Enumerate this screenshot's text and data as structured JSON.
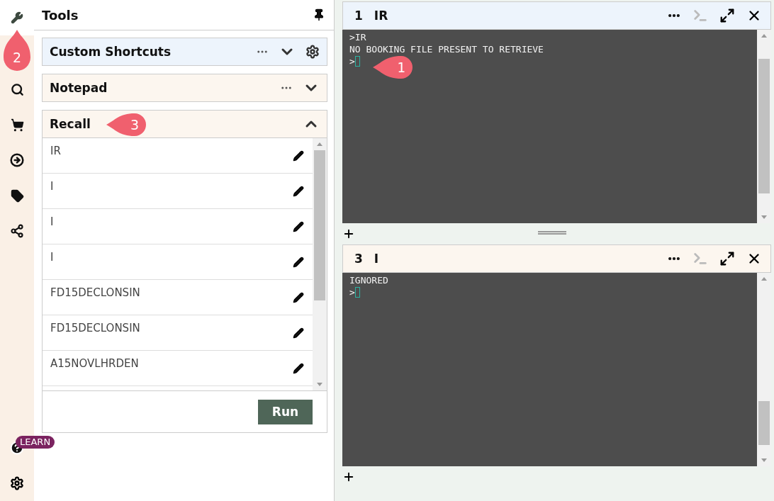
{
  "rail": {
    "items": [
      {
        "selected": true
      },
      {
        "selected": false
      },
      {
        "selected": false
      },
      {
        "selected": false
      },
      {
        "selected": false
      },
      {
        "selected": false
      }
    ],
    "callout": "2",
    "help": {
      "badge": "LEARN"
    }
  },
  "tools": {
    "title": "Tools",
    "sections": [
      {
        "kind": "shortcuts",
        "title": "Custom Shortcuts",
        "expanded": false
      },
      {
        "kind": "notepad",
        "title": "Notepad",
        "expanded": false
      },
      {
        "kind": "recall",
        "title": "Recall",
        "expanded": true,
        "callout": "3",
        "entries": [
          "IR",
          "I",
          "I",
          "I",
          "FD15DECLONSIN",
          "FD15DECLONSIN",
          "A15NOVLHRDEN"
        ],
        "run_label": "Run"
      }
    ]
  },
  "terminals": [
    {
      "number": "1",
      "title": "IR",
      "active": true,
      "lines": [
        ">IR",
        "NO BOOKING FILE PRESENT TO RETRIEVE"
      ],
      "prompt": ">",
      "callout": "1"
    },
    {
      "number": "3",
      "title": "I",
      "active": false,
      "lines": [
        "IGNORED"
      ],
      "prompt": ">"
    }
  ]
}
